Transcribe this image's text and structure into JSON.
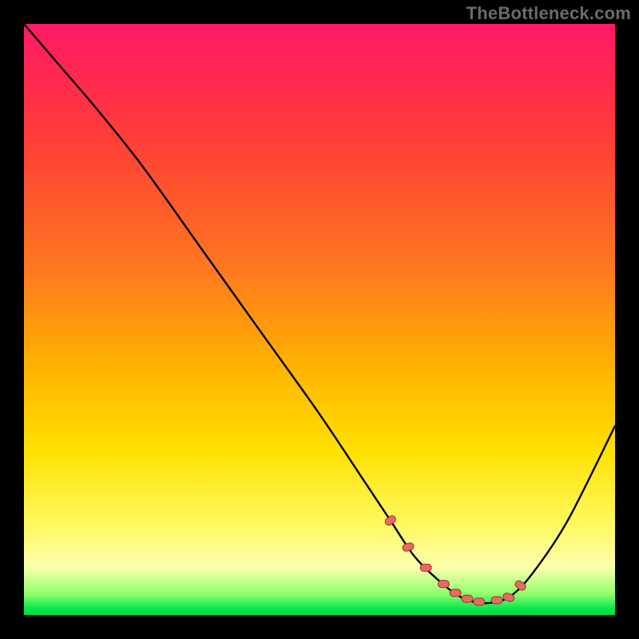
{
  "watermark": "TheBottleneck.com",
  "colors": {
    "curve_stroke": "#000000",
    "marker_fill": "#e86b63",
    "marker_stroke": "#9c2f29",
    "plot_border": "#000000"
  },
  "chart_data": {
    "type": "line",
    "title": "",
    "xlabel": "",
    "ylabel": "",
    "xlim": [
      0,
      100
    ],
    "ylim": [
      0,
      100
    ],
    "grid": false,
    "legend": false,
    "series": [
      {
        "name": "bottleneck_curve",
        "x": [
          0,
          6,
          12,
          20,
          30,
          40,
          50,
          58,
          62,
          66,
          70,
          74,
          78,
          82,
          86,
          92,
          100
        ],
        "y": [
          100,
          93,
          86,
          76,
          62,
          48,
          34,
          22,
          16,
          10,
          6,
          3,
          2,
          3,
          7,
          16,
          32
        ]
      }
    ],
    "optimal_range": {
      "x_start": 62,
      "x_end": 84,
      "markers_x": [
        62,
        65,
        68,
        71,
        73,
        75,
        77,
        80,
        82,
        84
      ],
      "y_approx": 3
    },
    "gradient_stops": [
      {
        "pos": 0,
        "color": "#ff1a66"
      },
      {
        "pos": 0.42,
        "color": "#ff7a1f"
      },
      {
        "pos": 0.72,
        "color": "#ffe000"
      },
      {
        "pos": 0.92,
        "color": "#fbffae"
      },
      {
        "pos": 0.99,
        "color": "#00e84a"
      },
      {
        "pos": 1.0,
        "color": "#00d63f"
      }
    ]
  }
}
